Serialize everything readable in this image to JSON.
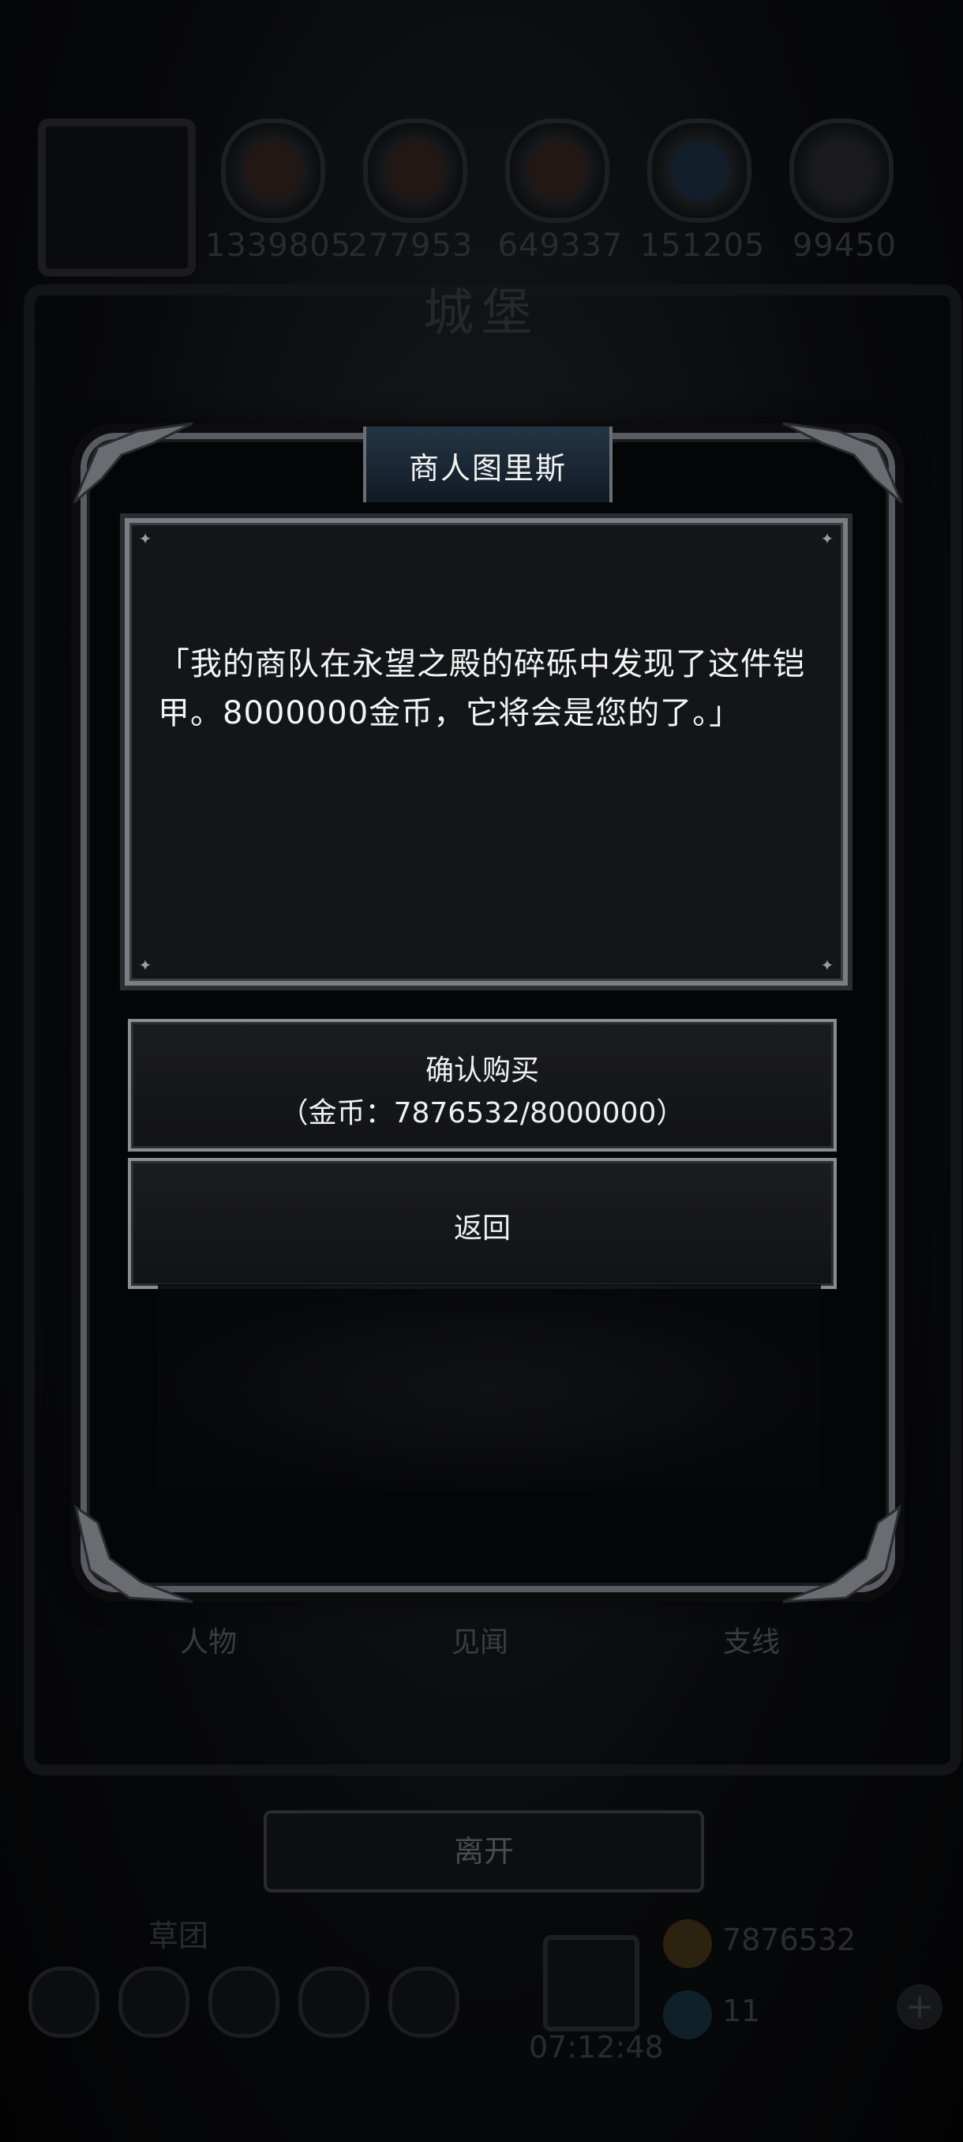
{
  "background": {
    "resources": [
      "1339805",
      "277953",
      "649337",
      "151205",
      "99450"
    ],
    "castle_title": "城堡",
    "tabs": [
      "人物",
      "见闻",
      "支线"
    ],
    "leave_button": "离开",
    "bottom": {
      "guild_label": "草团",
      "timer": "07:12:48",
      "gold": "7876532",
      "gems": "11",
      "plus": "+"
    }
  },
  "dialog": {
    "title": "商人图里斯",
    "message": "「我的商队在永望之殿的碎砾中发现了这件铠甲。8000000金币，它将会是您的了。」",
    "confirm_label": "确认购买",
    "confirm_cost": "（金币：7876532/8000000）",
    "back_label": "返回"
  },
  "colors": {
    "frame": "#5a5c63",
    "button_border": "#8a8c92",
    "header_band": "#253545"
  }
}
